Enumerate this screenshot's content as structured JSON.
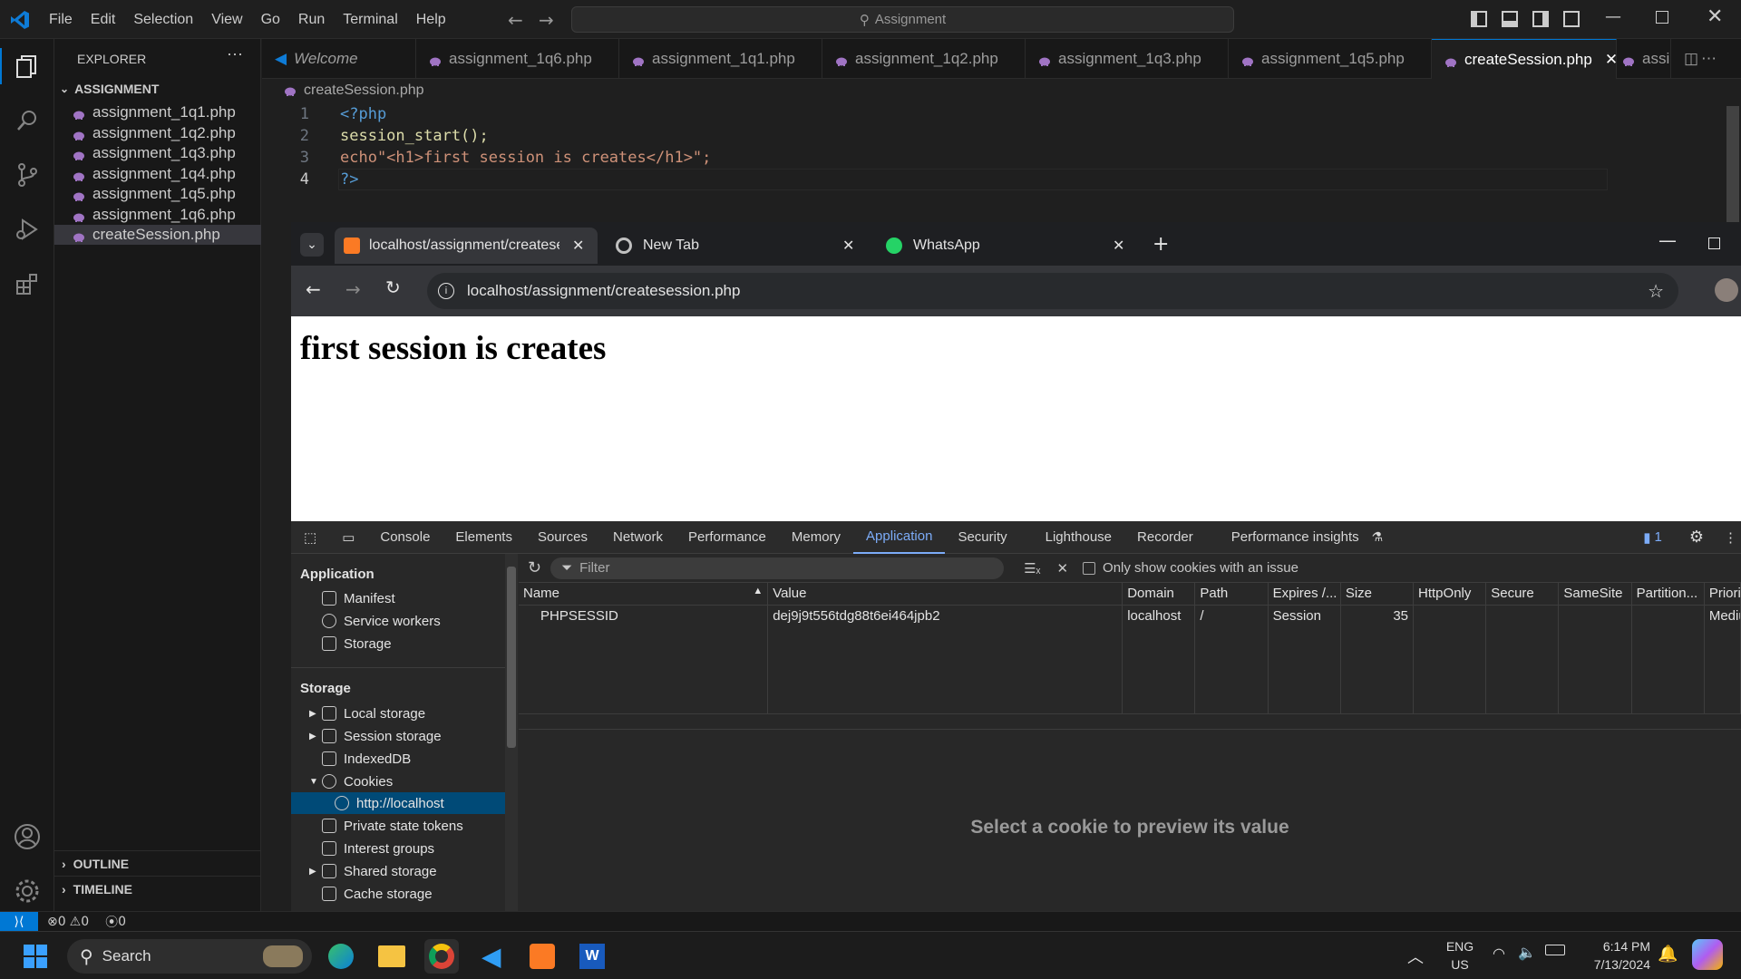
{
  "vscode": {
    "menu": [
      "File",
      "Edit",
      "Selection",
      "View",
      "Go",
      "Run",
      "Terminal",
      "Help"
    ],
    "command_center": "Assignment",
    "explorer": {
      "title": "EXPLORER",
      "folder": "ASSIGNMENT",
      "files": [
        "assignment_1q1.php",
        "assignment_1q2.php",
        "assignment_1q3.php",
        "assignment_1q4.php",
        "assignment_1q5.php",
        "assignment_1q6.php",
        "createSession.php"
      ],
      "selected": "createSession.php",
      "outline": "OUTLINE",
      "timeline": "TIMELINE"
    },
    "tabs": [
      "Welcome",
      "assignment_1q6.php",
      "assignment_1q1.php",
      "assignment_1q2.php",
      "assignment_1q3.php",
      "assignment_1q5.php",
      "createSession.php",
      "assign"
    ],
    "active_tab": "createSession.php",
    "breadcrumb": "createSession.php",
    "code_lines": [
      {
        "n": "1",
        "text": "<?php"
      },
      {
        "n": "2",
        "text": "session_start();"
      },
      {
        "n": "3",
        "text": "echo\"<h1>first session is creates</h1>\";"
      },
      {
        "n": "4",
        "text": "?>"
      }
    ],
    "status": {
      "errors": "0",
      "warnings": "0",
      "ports": "0"
    }
  },
  "browser": {
    "tabs": [
      {
        "title": "localhost/assignment/createses",
        "active": true
      },
      {
        "title": "New Tab",
        "active": false
      },
      {
        "title": "WhatsApp",
        "active": false
      }
    ],
    "url": "localhost/assignment/createsession.php",
    "page_heading": "first session is creates"
  },
  "devtools": {
    "tabs": [
      "Console",
      "Elements",
      "Sources",
      "Network",
      "Performance",
      "Memory",
      "Application",
      "Security",
      "Lighthouse",
      "Recorder",
      "Performance insights"
    ],
    "active_tab": "Application",
    "issues_count": "1",
    "sidebar": {
      "application_header": "Application",
      "application_items": [
        "Manifest",
        "Service workers",
        "Storage"
      ],
      "storage_header": "Storage",
      "storage_items": [
        "Local storage",
        "Session storage",
        "IndexedDB",
        "Cookies",
        "http://localhost",
        "Private state tokens",
        "Interest groups",
        "Shared storage",
        "Cache storage"
      ]
    },
    "filter_placeholder": "Filter",
    "only_issues_label": "Only show cookies with an issue",
    "columns": [
      "Name",
      "Value",
      "Domain",
      "Path",
      "Expires /...",
      "Size",
      "HttpOnly",
      "Secure",
      "SameSite",
      "Partition...",
      "Priorit"
    ],
    "cookie": {
      "name": "PHPSESSID",
      "value": "dej9j9t556tdg88t6ei464jpb2",
      "domain": "localhost",
      "path": "/",
      "expires": "Session",
      "size": "35",
      "priority": "Mediu"
    },
    "preview_hint": "Select a cookie to preview its value"
  },
  "taskbar": {
    "search": "Search",
    "lang1": "ENG",
    "lang2": "US",
    "time": "6:14 PM",
    "date": "7/13/2024"
  }
}
